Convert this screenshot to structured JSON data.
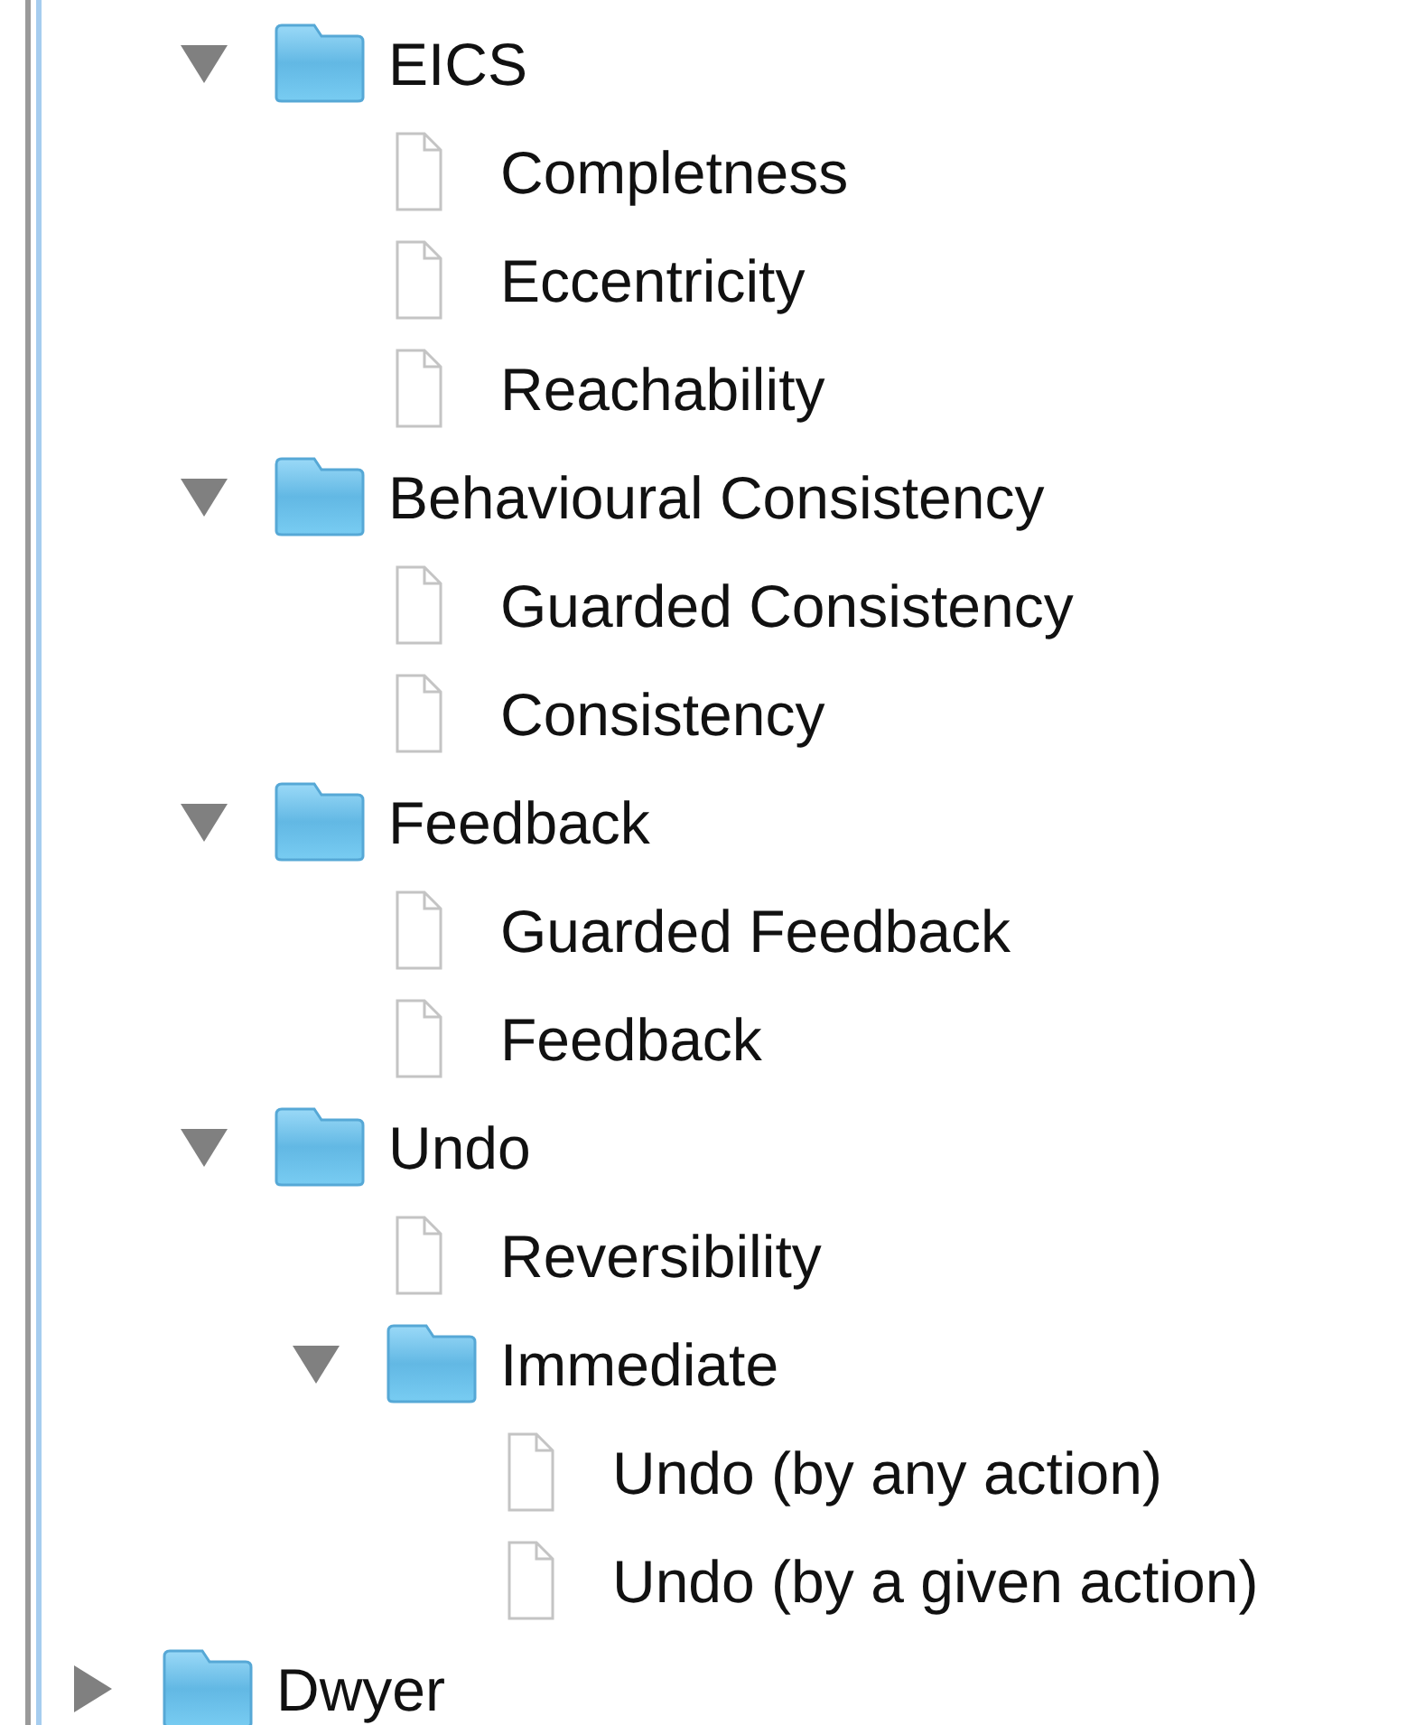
{
  "tree": [
    {
      "children": [
        {
          "kind": "folder",
          "label": "EICS",
          "expanded": true,
          "children": [
            {
              "kind": "file",
              "label": "Completness"
            },
            {
              "kind": "file",
              "label": "Eccentricity"
            },
            {
              "kind": "file",
              "label": "Reachability"
            }
          ]
        },
        {
          "kind": "folder",
          "label": "Behavioural Consistency",
          "expanded": true,
          "children": [
            {
              "kind": "file",
              "label": "Guarded Consistency"
            },
            {
              "kind": "file",
              "label": "Consistency"
            }
          ]
        },
        {
          "kind": "folder",
          "label": "Feedback",
          "expanded": true,
          "children": [
            {
              "kind": "file",
              "label": "Guarded Feedback"
            },
            {
              "kind": "file",
              "label": "Feedback"
            }
          ]
        },
        {
          "kind": "folder",
          "label": "Undo",
          "expanded": true,
          "children": [
            {
              "kind": "file",
              "label": "Reversibility"
            },
            {
              "kind": "folder",
              "label": "Immediate",
              "expanded": true,
              "children": [
                {
                  "kind": "file",
                  "label": "Undo (by any action)"
                },
                {
                  "kind": "file",
                  "label": "Undo (by a given action)"
                }
              ]
            }
          ]
        }
      ]
    },
    {
      "kind": "folder",
      "label": "Dwyer",
      "expanded": false
    }
  ]
}
